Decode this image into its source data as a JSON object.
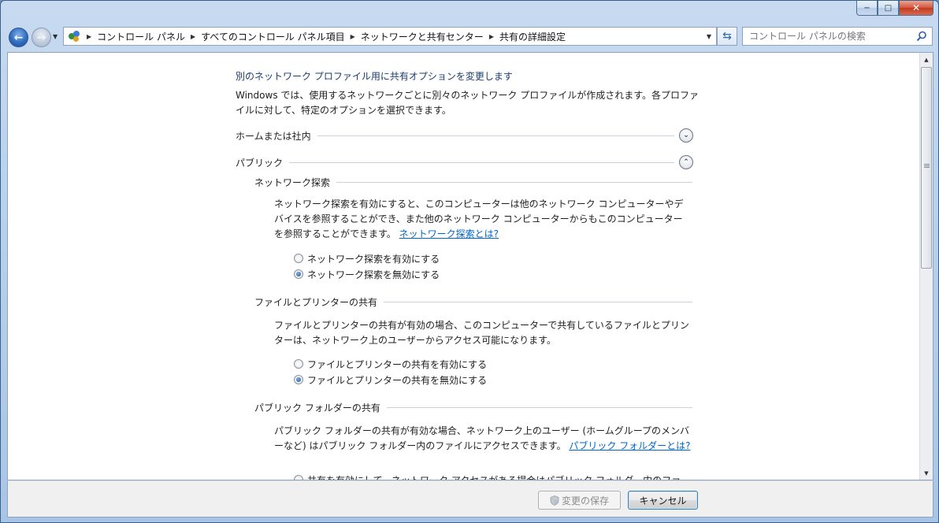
{
  "window": {
    "minimize": "−",
    "maximize": "□",
    "close": "✕"
  },
  "nav": {
    "back_glyph": "←",
    "forward_glyph": "→",
    "breadcrumbs": [
      "コントロール パネル",
      "すべてのコントロール パネル項目",
      "ネットワークと共有センター",
      "共有の詳細設定"
    ],
    "search_placeholder": "コントロール パネルの検索"
  },
  "page": {
    "title_link": "別のネットワーク プロファイル用に共有オプションを変更します",
    "intro": "Windows では、使用するネットワークごとに別々のネットワーク プロファイルが作成されます。各プロファイルに対して、特定のオプションを選択できます。",
    "profiles": {
      "home": {
        "label": "ホームまたは社内",
        "toggle": "⌄"
      },
      "public": {
        "label": "パブリック",
        "toggle": "⌃"
      }
    },
    "network_discovery": {
      "header": "ネットワーク探索",
      "desc": "ネットワーク探索を有効にすると、このコンピューターは他のネットワーク コンピューターやデバイスを参照することができ、また他のネットワーク コンピューターからもこのコンピューターを参照することができます。",
      "link": "ネットワーク探索とは?",
      "option_on": "ネットワーク探索を有効にする",
      "option_off": "ネットワーク探索を無効にする",
      "selected": "off"
    },
    "file_printer": {
      "header": "ファイルとプリンターの共有",
      "desc": "ファイルとプリンターの共有が有効の場合、このコンピューターで共有しているファイルとプリンターは、ネットワーク上のユーザーからアクセス可能になります。",
      "option_on": "ファイルとプリンターの共有を有効にする",
      "option_off": "ファイルとプリンターの共有を無効にする",
      "selected": "off"
    },
    "public_folder": {
      "header": "パブリック フォルダーの共有",
      "desc": "パブリック フォルダーの共有が有効な場合、ネットワーク上のユーザー (ホームグループのメンバーなど) はパブリック フォルダー内のファイルにアクセスできます。",
      "link": "パブリック フォルダーとは?",
      "partial_option": "共有を有効にして、ネットワーク アクセスがある場合はパブリック フォルダー内のファ"
    }
  },
  "buttons": {
    "save": "変更の保存",
    "cancel": "キャンセル"
  },
  "colors": {
    "link": "#0066cc",
    "title_link": "#1a3e6e",
    "frame": "#b9d1ec"
  }
}
